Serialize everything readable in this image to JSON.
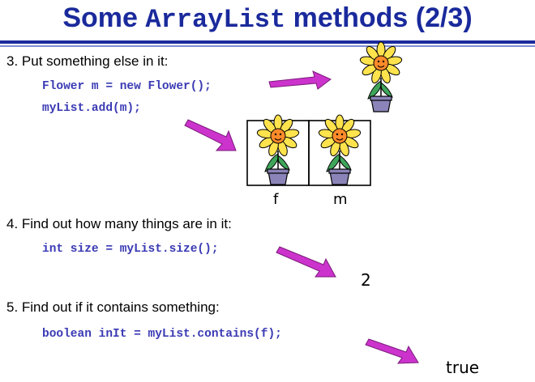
{
  "title": {
    "prefix": "Some ",
    "code": "ArrayList",
    "suffix": " methods (2/3)"
  },
  "steps": [
    {
      "label": "3. Put something else in it:",
      "code": [
        "Flower m = new Flower();",
        "myList.add(m);"
      ]
    },
    {
      "label": "4. Find out how many things are in it:",
      "code": [
        "int size = myList.size();"
      ]
    },
    {
      "label": "5. Find out if it contains something:",
      "code": [
        "boolean inIt = myList.contains(f);"
      ]
    }
  ],
  "list_labels": [
    "f",
    "m"
  ],
  "size_result": "2",
  "contains_result": "true",
  "colors": {
    "title": "#1a2a9c",
    "code": "#3a3ab4",
    "arrow": "#cc33cc",
    "petal": "#ffe34d",
    "center": "#ff8a2a",
    "pot": "#8a84b8",
    "leaf": "#3fa55a"
  },
  "icons": [
    "arrow-icon",
    "flower-icon"
  ]
}
